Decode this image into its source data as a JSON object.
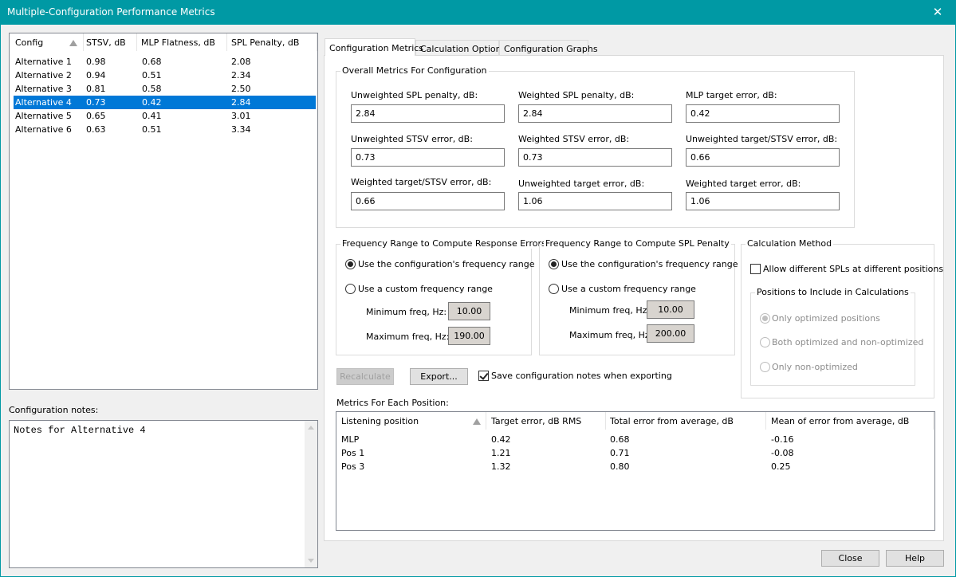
{
  "window": {
    "title": "Multiple-Configuration Performance Metrics",
    "close_glyph": "✕"
  },
  "config_list": {
    "headers": [
      "Config",
      "STSV, dB",
      "MLP Flatness, dB",
      "SPL Penalty, dB"
    ],
    "rows": [
      {
        "config": "Alternative 1",
        "stsv": "0.98",
        "mlp": "0.68",
        "spl": "2.08"
      },
      {
        "config": "Alternative 2",
        "stsv": "0.94",
        "mlp": "0.51",
        "spl": "2.34"
      },
      {
        "config": "Alternative 3",
        "stsv": "0.81",
        "mlp": "0.58",
        "spl": "2.50"
      },
      {
        "config": "Alternative 4",
        "stsv": "0.73",
        "mlp": "0.42",
        "spl": "2.84"
      },
      {
        "config": "Alternative 5",
        "stsv": "0.65",
        "mlp": "0.41",
        "spl": "3.01"
      },
      {
        "config": "Alternative 6",
        "stsv": "0.63",
        "mlp": "0.51",
        "spl": "3.34"
      }
    ],
    "selected": "Alternative 4"
  },
  "notes": {
    "label": "Configuration notes:",
    "text": "Notes for Alternative 4"
  },
  "tabs": [
    "Configuration Metrics",
    "Calculation Options",
    "Configuration Graphs"
  ],
  "overall": {
    "title": "Overall Metrics For Configuration",
    "metrics": [
      {
        "label": "Unweighted SPL penalty, dB:",
        "value": "2.84"
      },
      {
        "label": "Weighted SPL penalty, dB:",
        "value": "2.84"
      },
      {
        "label": "MLP target error, dB:",
        "value": "0.42"
      },
      {
        "label": "Unweighted STSV error, dB:",
        "value": "0.73"
      },
      {
        "label": "Weighted STSV error, dB:",
        "value": "0.73"
      },
      {
        "label": "Unweighted target/STSV error, dB:",
        "value": "0.66"
      },
      {
        "label": "Weighted target/STSV error, dB:",
        "value": "0.66"
      },
      {
        "label": "Unweighted target error, dB:",
        "value": "1.06"
      },
      {
        "label": "Weighted target error, dB:",
        "value": "1.06"
      }
    ]
  },
  "freq_response": {
    "title": "Frequency Range to Compute Response Errors",
    "opt_config": "Use the configuration's frequency range",
    "opt_custom": "Use a custom frequency range",
    "min_label": "Minimum freq, Hz:",
    "min_value": "10.00",
    "max_label": "Maximum freq, Hz:",
    "max_value": "190.00"
  },
  "freq_spl": {
    "title": "Frequency Range to Compute SPL Penalty",
    "opt_config": "Use the configuration's frequency range",
    "opt_custom": "Use a custom frequency range",
    "min_label": "Minimum freq, Hz:",
    "min_value": "10.00",
    "max_label": "Maximum freq, Hz:",
    "max_value": "200.00"
  },
  "calc_method": {
    "title": "Calculation Method",
    "allow_label": "Allow different SPLs at different positions",
    "positions_title": "Positions to Include in Calculations",
    "opt_only_opt": "Only optimized positions",
    "opt_both": "Both optimized and non-optimized",
    "opt_only_non": "Only non-optimized"
  },
  "actions": {
    "recalculate": "Recalculate",
    "export": "Export...",
    "save_notes": "Save configuration notes when exporting"
  },
  "positions": {
    "title": "Metrics For Each Position:",
    "headers": [
      "Listening position",
      "Target error, dB RMS",
      "Total error from average, dB",
      "Mean of error from average, dB"
    ],
    "rows": [
      {
        "pos": "MLP",
        "target": "0.42",
        "total": "0.68",
        "mean": "-0.16"
      },
      {
        "pos": "Pos 1",
        "target": "1.21",
        "total": "0.71",
        "mean": "-0.08"
      },
      {
        "pos": "Pos 3",
        "target": "1.32",
        "total": "0.80",
        "mean": "0.25"
      }
    ]
  },
  "footer": {
    "close": "Close",
    "help": "Help"
  },
  "colors": {
    "titlebar": "#0099a4",
    "selection": "#0078d7"
  }
}
